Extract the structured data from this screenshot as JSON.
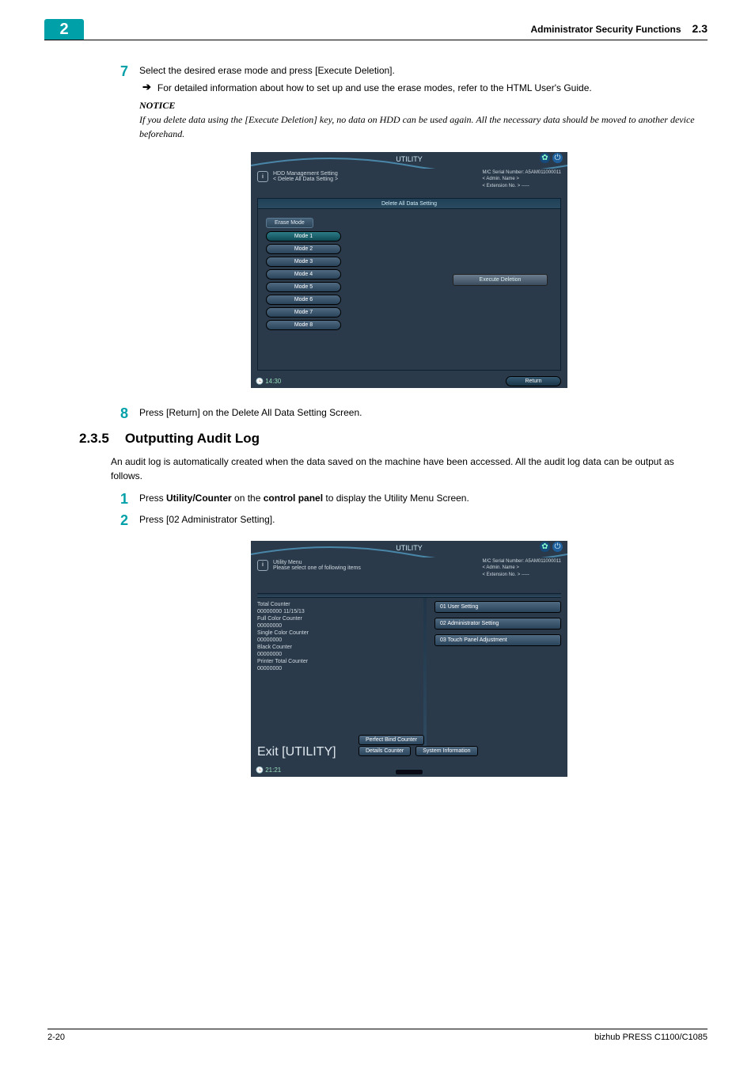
{
  "header": {
    "chapter_number": "2",
    "title": "Administrator Security Functions",
    "section_number": "2.3"
  },
  "step7": {
    "num": "7",
    "text": "Select the desired erase mode and press [Execute Deletion].",
    "bullet": "For detailed information about how to set up and use the erase modes, refer to the HTML User's Guide.",
    "notice_head": "NOTICE",
    "notice_body": "If you delete data using the [Execute Deletion] key, no data on HDD can be used again. All the necessary data should be moved to another device beforehand."
  },
  "shot1": {
    "title": "UTILITY",
    "bread": "HDD Management Setting\n< Delete All Data Setting >",
    "meta": {
      "serial": "M/C Serial Number: A5AM011000011",
      "admin": "< Admin. Name >",
      "ext": "< Extension No. > -----"
    },
    "panel_title": "Delete All Data Setting",
    "erase_label": "Erase Mode",
    "modes": [
      "Mode 1",
      "Mode 2",
      "Mode 3",
      "Mode 4",
      "Mode 5",
      "Mode 6",
      "Mode 7",
      "Mode 8"
    ],
    "exec": "Execute Deletion",
    "return": "Return",
    "time": "14:30"
  },
  "step8": {
    "num": "8",
    "text": "Press [Return] on the Delete All Data Setting Screen."
  },
  "section": {
    "num": "2.3.5",
    "title": "Outputting Audit Log",
    "intro": "An audit log is automatically created when the data saved on the machine have been accessed. All the audit log data can be output as follows."
  },
  "step1b": {
    "num": "1",
    "pre": "Press ",
    "b1": "Utility/Counter",
    "mid": " on the ",
    "b2": "control panel",
    "post": " to display the Utility Menu Screen."
  },
  "step2b": {
    "num": "2",
    "text": "Press [02 Administrator Setting]."
  },
  "shot2": {
    "title": "UTILITY",
    "bread": "Utility Menu\nPlease select one of following items",
    "meta": {
      "serial": "M/C Serial Number: A5AM011000011",
      "admin": "< Admin. Name >",
      "ext": "< Extension No. > -----"
    },
    "left": {
      "l1": "Total Counter",
      "l1v": "00000000    11/15/13",
      "l2": "Full Color Counter",
      "l2v": "00000000",
      "l3": "Single Color Counter",
      "l3v": "00000000",
      "l4": "Black Counter",
      "l4v": "00000000",
      "l5": "Printer Total Counter",
      "l5v": "00000000"
    },
    "right": {
      "r1": "01 User Setting",
      "r2": "02 Administrator Setting",
      "r3": "03 Touch Panel Adjustment"
    },
    "bottom": {
      "pb": "Perfect Bind Counter",
      "dc": "Details Counter",
      "si": "System Information"
    },
    "exit": "Exit [UTILITY]",
    "time": "21:21"
  },
  "footer": {
    "left": "2-20",
    "right": "bizhub PRESS C1100/C1085"
  }
}
